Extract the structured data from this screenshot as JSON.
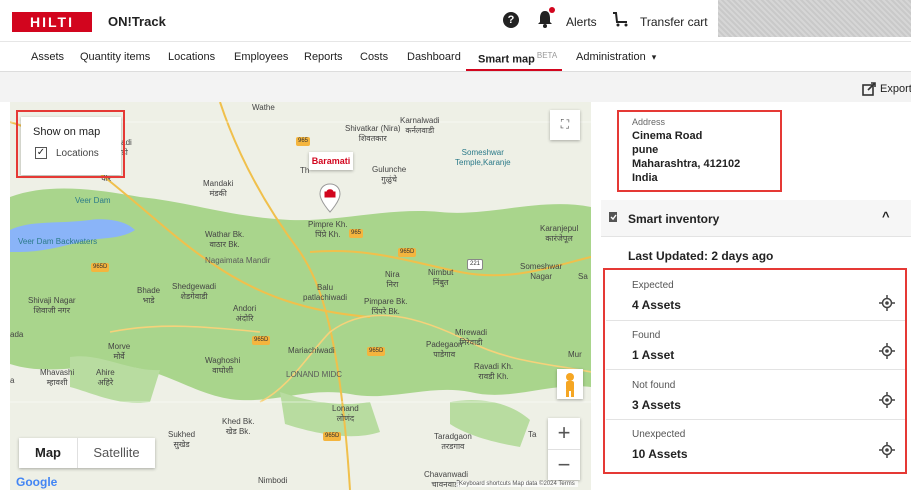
{
  "header": {
    "logo_text": "HILTI",
    "app_name": "ON!Track",
    "help_glyph": "?",
    "alerts_label": "Alerts",
    "transfer_label": "Transfer cart"
  },
  "nav": {
    "items": [
      "Assets",
      "Quantity items",
      "Locations",
      "Employees",
      "Reports",
      "Costs",
      "Dashboard"
    ],
    "active_label": "Smart map",
    "active_badge": "BETA",
    "admin_label": "Administration",
    "admin_caret": "▾"
  },
  "toolbar": {
    "export_label": "Export"
  },
  "map": {
    "show_on_map_title": "Show on map",
    "layer_label": "Locations",
    "layer_checked": true,
    "pin_label": "Baramati",
    "fullscreen_glyph": "⛶",
    "zoom_in": "+",
    "zoom_out": "−",
    "type_map": "Map",
    "type_satellite": "Satellite",
    "google_logo": "Google",
    "copyright": "Keyboard shortcuts   Map data ©2024   Terms",
    "place_labels": [
      "Malawadi\nमाळवाडी",
      "Veer\nवीर",
      "Mandaki\nमंडकी",
      "Shivatkar (Nira)\nशिवतकार",
      "Karnalwadi\nकर्नलवाडी",
      "Gulunche\nगुळुंचे",
      "Someshwar\nTemple,Karanje",
      "Pimpre Kh.\nपिंप्रे Kh.",
      "Karanjepul\nकारंजेपूल",
      "Veer Dam Backwaters",
      "Wathar Bk.\nवाठार Bk.",
      "Nagaimata Mandir",
      "Bhade\nभाडे",
      "Shedgewadi\nशेडगेवाडी",
      "Balu\npatlachiwadi",
      "Nira\nनिरा",
      "Nimbut\nनिंबुत",
      "Someshwar\nNagar",
      "Shivaji Nagar\nशिवाजी नगर",
      "Andori\nअंदोरि",
      "Pimpare Bk.\nपिंपरे Bk.",
      "Morve\nमोर्वे",
      "Mirewadi\nमिरेवाडी",
      "Padegaon\nपाडेगाव",
      "Waghoshi\nवाघोशी",
      "Mariachiwadi",
      "Mhavashi\nम्हावशी",
      "Ahire\nअहिरे",
      "LONAND MIDC",
      "Ravadi Kh.\nरावडी Kh.",
      "Lonand\nलोणंद",
      "Khed Bk.\nखेड Bk.",
      "Sukhed\nसुखेड",
      "Taradgaon\nतरडगाव",
      "Chavanwadi\nचावनवाडी",
      "Nimbodi",
      "Wathe",
      "Veer Dam",
      "Th",
      "Sa",
      "Mur",
      "Ta",
      "ada",
      "a"
    ],
    "road_tags": [
      "965",
      "965",
      "965D",
      "965D",
      "221",
      "965D",
      "965D",
      "965D"
    ]
  },
  "address": {
    "caption": "Address",
    "lines": [
      "Cinema Road",
      "pune",
      "Maharashtra, 412102",
      "India"
    ]
  },
  "inventory": {
    "title": "Smart inventory",
    "collapse_glyph": "^",
    "last_updated": "Last Updated: 2 days ago",
    "stats": [
      {
        "label": "Expected",
        "value": "4 Assets"
      },
      {
        "label": "Found",
        "value": "1 Asset"
      },
      {
        "label": "Not found",
        "value": "3 Assets"
      },
      {
        "label": "Unexpected",
        "value": "10 Assets"
      }
    ]
  },
  "colors": {
    "brand_red": "#d2051e",
    "highlight_red": "#e53935",
    "map_green": "#a9d58c",
    "water": "#8ab4f8"
  }
}
